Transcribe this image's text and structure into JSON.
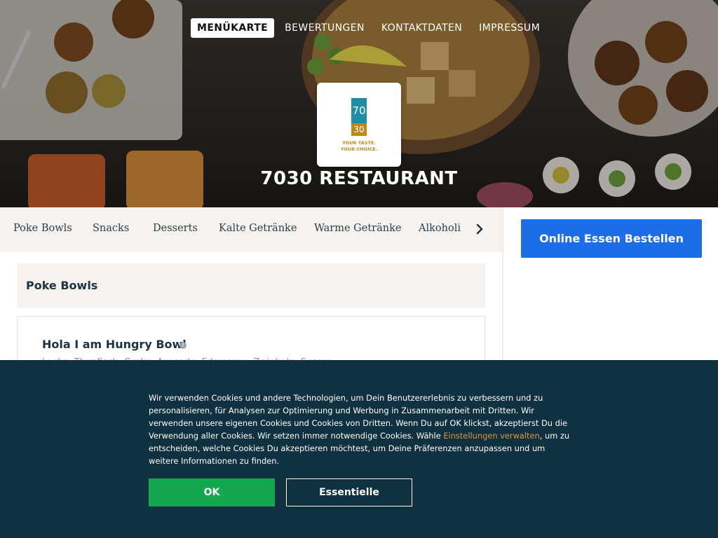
{
  "colors": {
    "accent_blue": "#1d6ce8",
    "cookie_bg": "#0f3140",
    "ok_green": "#14a750",
    "link_orange": "#e8913a",
    "logo_teal": "#1c8fa6",
    "logo_gold": "#c08a1a",
    "dark_text": "#1b3540"
  },
  "top_nav": {
    "items": [
      {
        "label": "MENÜKARTE",
        "active": true
      },
      {
        "label": "BEWERTUNGEN",
        "active": false
      },
      {
        "label": "KONTAKTDATEN",
        "active": false
      },
      {
        "label": "IMPRESSUM",
        "active": false
      }
    ]
  },
  "logo": {
    "top_text": "70",
    "bottom_text": "30",
    "tagline_line1": "YOUR TASTE.",
    "tagline_line2": "YOUR CHOICE."
  },
  "restaurant_name": "7030 RESTAURANT",
  "categories": {
    "items": [
      "Poke Bowls",
      "Snacks",
      "Desserts",
      "Kalte Getränke",
      "Warme Getränke",
      "Alkoholi"
    ],
    "next_icon": "chevron-right-icon"
  },
  "section": {
    "title": "Poke Bowls"
  },
  "menu_item": {
    "name": "Hola I am Hungry Bowl",
    "info_icon": "info-icon",
    "description": "Lachs, Thunfisch, Gurke, Avocado, Edamame, Zwiebeln, Sesam"
  },
  "sidebar": {
    "order_button": "Online Essen Bestellen"
  },
  "cookie_banner": {
    "text_before_link": "Wir verwenden Cookies und andere Technologien, um Dein Benutzererlebnis zu verbessern und zu personalisieren, für Analysen zur Optimierung und Werbung in Zusammenarbeit mit Dritten. Wir verwenden unsere eigenen Cookies und Cookies von Dritten. Wenn Du auf OK klickst, akzeptierst Du die Verwendung aller Cookies. Wir setzen immer notwendige Cookies. Wähle ",
    "link_text": "Einstellungen verwalten",
    "text_after_link": ", um zu entscheiden, welche Cookies Du akzeptieren möchtest, um Deine Präferenzen anzupassen und um weitere Informationen zu finden.",
    "ok_button": "OK",
    "essential_button": "Essentielle"
  }
}
